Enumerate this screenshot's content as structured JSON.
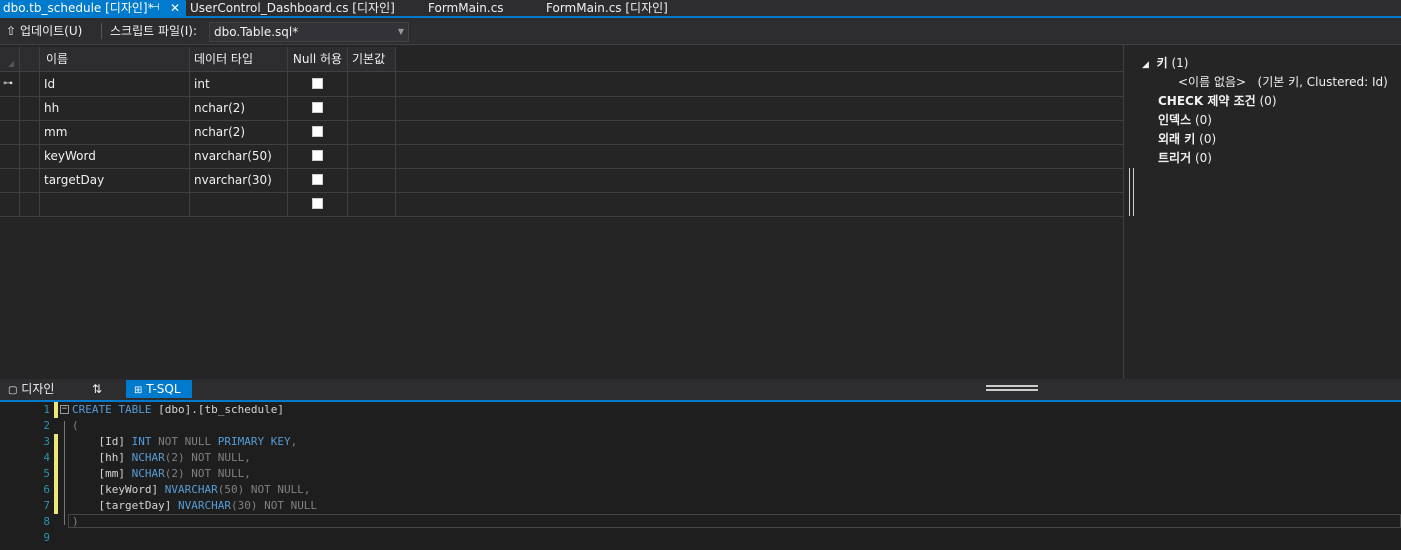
{
  "tabs": [
    {
      "label": "dbo.tb_schedule [디자인]*",
      "active": true
    },
    {
      "label": "UserControl_Dashboard.cs [디자인]",
      "active": false
    },
    {
      "label": "FormMain.cs",
      "active": false
    },
    {
      "label": "FormMain.cs [디자인]",
      "active": false
    }
  ],
  "toolbar": {
    "update_label": "업데이트(U)",
    "script_label": "스크립트 파일(I):",
    "script_file": "dbo.Table.sql*"
  },
  "grid": {
    "headers": [
      "이름",
      "데이터 타입",
      "Null 허용",
      "기본값"
    ],
    "rows": [
      {
        "name": "Id",
        "type": "int",
        "pk": true
      },
      {
        "name": "hh",
        "type": "nchar(2)",
        "pk": false
      },
      {
        "name": "mm",
        "type": "nchar(2)",
        "pk": false
      },
      {
        "name": "keyWord",
        "type": "nvarchar(50)",
        "pk": false
      },
      {
        "name": "targetDay",
        "type": "nvarchar(30)",
        "pk": false
      },
      {
        "name": "",
        "type": "",
        "pk": false
      }
    ]
  },
  "properties": {
    "keys_label": "키",
    "keys_count": "(1)",
    "key_item_name": "<이름 없음>",
    "key_item_desc": "(기본 키, Clustered: Id)",
    "check_label": "CHECK 제약 조건",
    "check_count": "(0)",
    "index_label": "인덱스",
    "index_count": "(0)",
    "fk_label": "외래 키",
    "fk_count": "(0)",
    "trigger_label": "트리거",
    "trigger_count": "(0)"
  },
  "bottom_tabs": {
    "design": "디자인",
    "swap": "⇅",
    "tsql": "T-SQL"
  },
  "code": {
    "line_numbers": [
      "1",
      "2",
      "3",
      "4",
      "5",
      "6",
      "7",
      "8",
      "9"
    ],
    "l1_kw": "CREATE TABLE",
    "l1_rest": " [dbo].[tb_schedule]",
    "l2": "(",
    "l3_name": "    [Id] ",
    "l3_type": "INT",
    "l3_mid": " NOT NULL ",
    "l3_kw": "PRIMARY KEY",
    "l3_end": ",",
    "l4_name": "    [hh] ",
    "l4_type": "NCHAR",
    "l4_args": "(2)",
    "l4_end": " NOT NULL,",
    "l5_name": "    [mm] ",
    "l5_type": "NCHAR",
    "l5_args": "(2)",
    "l5_end": " NOT NULL,",
    "l6_name": "    [keyWord] ",
    "l6_type": "NVARCHAR",
    "l6_args": "(50)",
    "l6_end": " NOT NULL,",
    "l7_name": "    [targetDay] ",
    "l7_type": "NVARCHAR",
    "l7_args": "(30)",
    "l7_end": " NOT NULL",
    "l8": ")"
  },
  "colors": {
    "accent": "#007acc",
    "keyword": "#569cd6",
    "line_number": "#2b91af",
    "change_marker": "#eee77a"
  }
}
